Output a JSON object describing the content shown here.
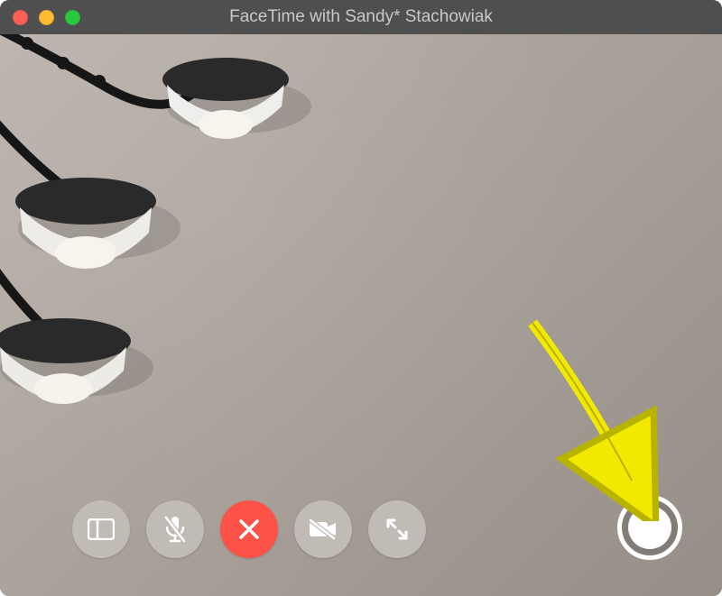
{
  "window": {
    "title": "FaceTime with Sandy* Stachowiak"
  },
  "controls": {
    "sidebar_label": "sidebar-button",
    "mute_label": "mute-button",
    "end_label": "end-call-button",
    "camera_label": "camera-off-button",
    "fullscreen_label": "fullscreen-button"
  },
  "shutter": {
    "label": "live-photo-shutter"
  },
  "colors": {
    "end_call": "#fc5247",
    "control_bg": "#c0bbb5",
    "annotation_arrow": "#f2e900"
  }
}
